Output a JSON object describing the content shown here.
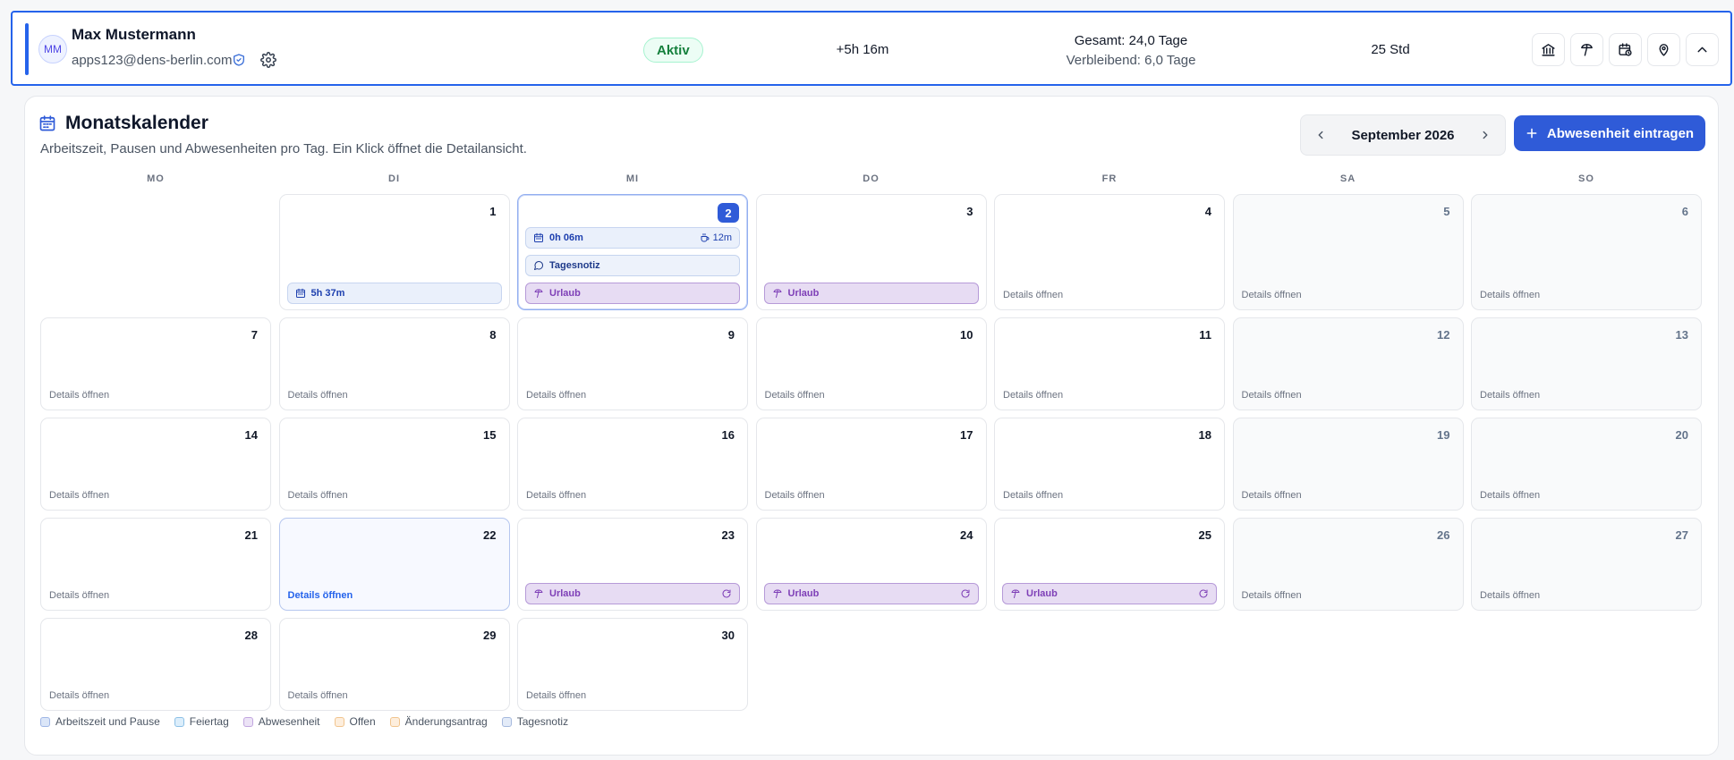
{
  "employee": {
    "initials": "MM",
    "name": "Max Mustermann",
    "email": "apps123@dens-berlin.com",
    "status": "Aktiv",
    "saldo": "+5h 16m",
    "vacation_total": "Gesamt: 24,0 Tage",
    "vacation_remaining": "Verbleibend: 6,0 Tage",
    "weekly_hours": "25 Std",
    "actions": [
      "bank-icon",
      "vacation-icon",
      "calendar-clock-icon",
      "location-pin-icon",
      "chevron-up-icon"
    ]
  },
  "calendar": {
    "title": "Monatskalender",
    "subtitle": "Arbeitszeit, Pausen und Abwesenheiten pro Tag. Ein Klick öffnet die Detailansicht.",
    "month_label": "September 2026",
    "add_button": "Abwesenheit eintragen",
    "weekdays": [
      "MO",
      "DI",
      "MI",
      "DO",
      "FR",
      "SA",
      "SO"
    ],
    "details_label": "Details öffnen",
    "leading_empty": 1,
    "today": 2,
    "hovered": 22,
    "days": [
      {
        "day": "1",
        "weekend": false,
        "chips": [
          {
            "type": "work",
            "label": "5h 37m"
          }
        ]
      },
      {
        "day": "2",
        "weekend": false,
        "chips": [
          {
            "type": "work",
            "label": "0h 06m",
            "extra": "12m"
          },
          {
            "type": "note",
            "label": "Tagesnotiz"
          },
          {
            "type": "abs",
            "label": "Urlaub"
          }
        ]
      },
      {
        "day": "3",
        "weekend": false,
        "chips": [
          {
            "type": "abs",
            "label": "Urlaub"
          }
        ]
      },
      {
        "day": "4",
        "weekend": false,
        "chips": []
      },
      {
        "day": "5",
        "weekend": true,
        "chips": []
      },
      {
        "day": "6",
        "weekend": true,
        "chips": []
      },
      {
        "day": "7",
        "weekend": false,
        "chips": []
      },
      {
        "day": "8",
        "weekend": false,
        "chips": []
      },
      {
        "day": "9",
        "weekend": false,
        "chips": []
      },
      {
        "day": "10",
        "weekend": false,
        "chips": []
      },
      {
        "day": "11",
        "weekend": false,
        "chips": []
      },
      {
        "day": "12",
        "weekend": true,
        "chips": []
      },
      {
        "day": "13",
        "weekend": true,
        "chips": []
      },
      {
        "day": "14",
        "weekend": false,
        "chips": []
      },
      {
        "day": "15",
        "weekend": false,
        "chips": []
      },
      {
        "day": "16",
        "weekend": false,
        "chips": []
      },
      {
        "day": "17",
        "weekend": false,
        "chips": []
      },
      {
        "day": "18",
        "weekend": false,
        "chips": []
      },
      {
        "day": "19",
        "weekend": true,
        "chips": []
      },
      {
        "day": "20",
        "weekend": true,
        "chips": []
      },
      {
        "day": "21",
        "weekend": false,
        "chips": []
      },
      {
        "day": "22",
        "weekend": false,
        "chips": []
      },
      {
        "day": "23",
        "weekend": false,
        "chips": [
          {
            "type": "abs",
            "label": "Urlaub",
            "pending": true
          }
        ]
      },
      {
        "day": "24",
        "weekend": false,
        "chips": [
          {
            "type": "abs",
            "label": "Urlaub",
            "pending": true
          }
        ]
      },
      {
        "day": "25",
        "weekend": false,
        "chips": [
          {
            "type": "abs",
            "label": "Urlaub",
            "pending": true
          }
        ]
      },
      {
        "day": "26",
        "weekend": true,
        "chips": []
      },
      {
        "day": "27",
        "weekend": true,
        "chips": []
      },
      {
        "day": "28",
        "weekend": false,
        "chips": []
      },
      {
        "day": "29",
        "weekend": false,
        "chips": []
      },
      {
        "day": "30",
        "weekend": false,
        "chips": []
      }
    ]
  },
  "legend": [
    {
      "label": "Arbeitszeit und Pause",
      "color": "#dbe6f8",
      "border": "#9fb6e6"
    },
    {
      "label": "Feiertag",
      "color": "#dceefb",
      "border": "#8cc0e6"
    },
    {
      "label": "Abwesenheit",
      "color": "#ece3f6",
      "border": "#c1a6df"
    },
    {
      "label": "Offen",
      "color": "#fdeedd",
      "border": "#f1c48e"
    },
    {
      "label": "Änderungsantrag",
      "color": "#fdeedd",
      "border": "#f1c48e"
    },
    {
      "label": "Tagesnotiz",
      "color": "#e3ebf8",
      "border": "#a5b8dd"
    }
  ]
}
